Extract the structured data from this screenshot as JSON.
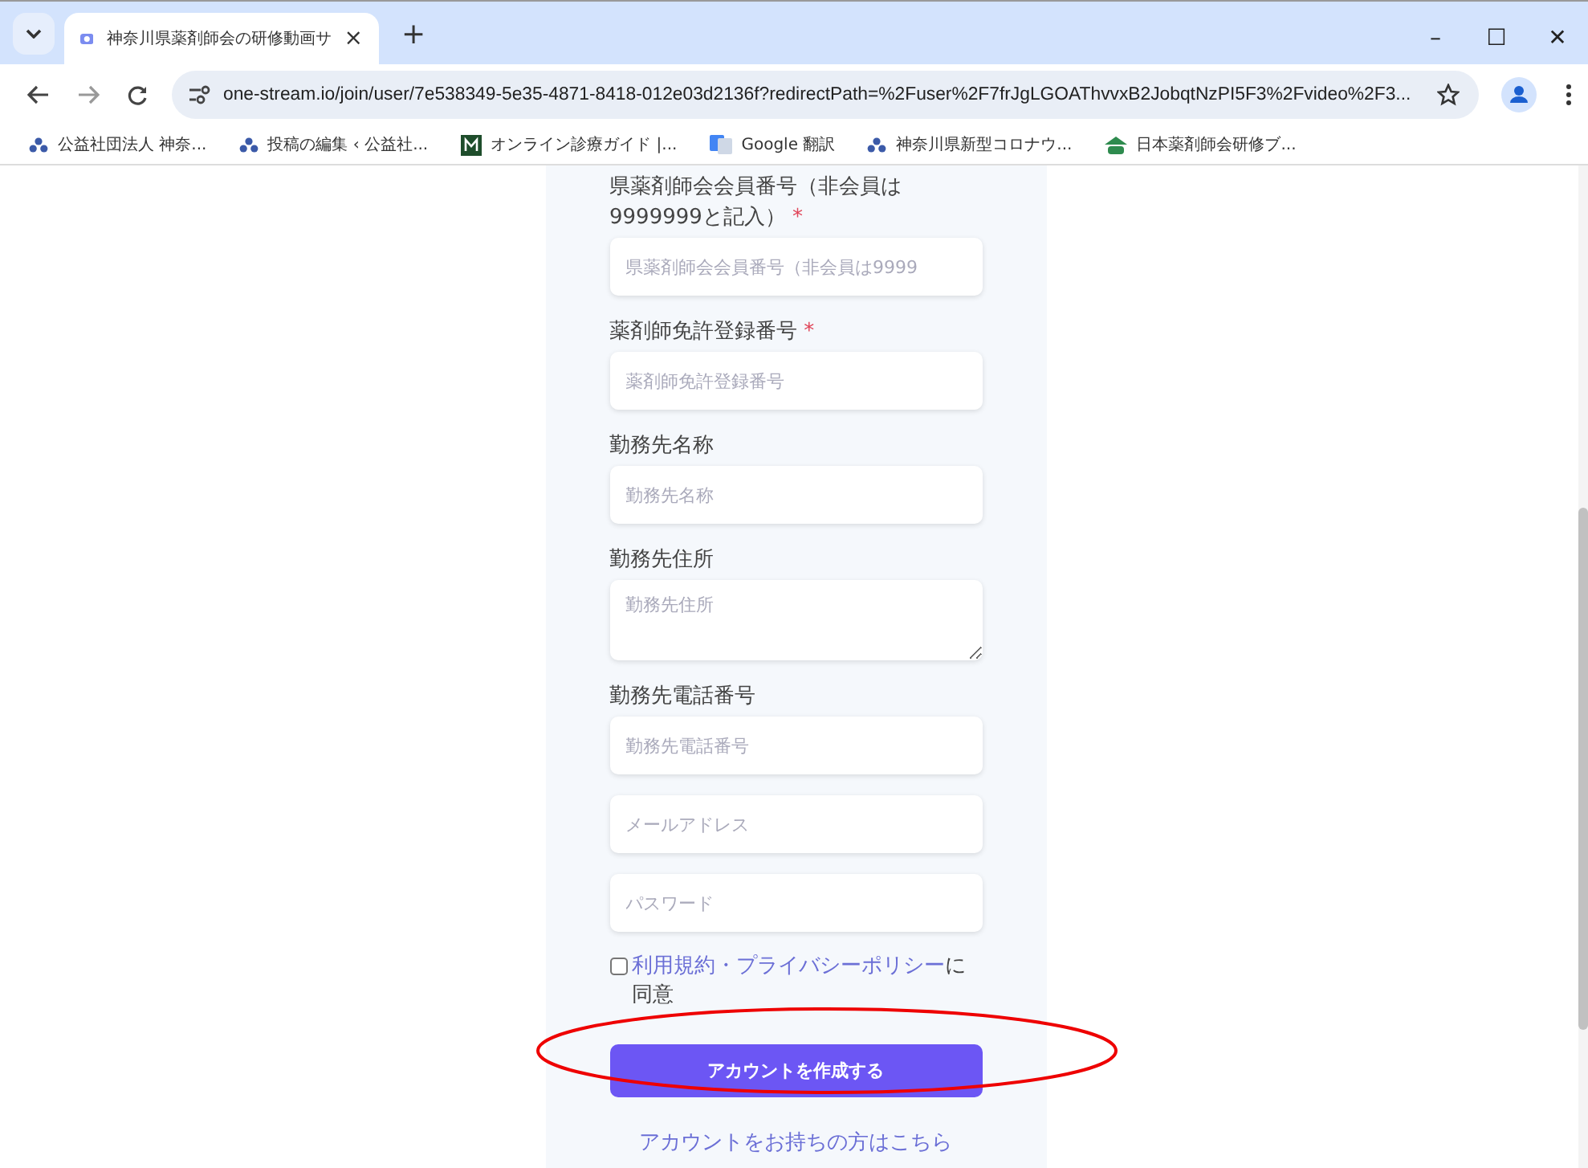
{
  "browser": {
    "tab": {
      "title": "神奈川県薬剤師会の研修動画サ",
      "close": "×"
    },
    "new_tab": "+",
    "window_controls": [
      "–",
      "☐",
      "✕"
    ],
    "url": "one-stream.io/join/user/7e538349-5e35-4871-8418-012e03d2136f?redirectPath=%2Fuser%2F7frJgLGOAThvvxB2JobqtNzPI5F3%2Fvideo%2F3...",
    "bookmarks": [
      {
        "label": "公益社団法人 神奈...",
        "kind": "people"
      },
      {
        "label": "投稿の編集 ‹ 公益社...",
        "kind": "people"
      },
      {
        "label": "オンライン診療ガイド |...",
        "kind": "m"
      },
      {
        "label": "Google 翻訳",
        "kind": "translate"
      },
      {
        "label": "神奈川県新型コロナウ...",
        "kind": "people"
      },
      {
        "label": "日本薬剤師会研修ブ...",
        "kind": "green"
      }
    ]
  },
  "form": {
    "fields": [
      {
        "label": "県薬剤師会会員番号（非会員は9999999と記入）",
        "required_mark": "*",
        "kind": "input",
        "placeholder": "県薬剤師会会員番号（非会員は9999"
      },
      {
        "label": "薬剤師免許登録番号",
        "required_mark": "*",
        "kind": "input",
        "placeholder": "薬剤師免許登録番号"
      },
      {
        "label": "勤務先名称",
        "kind": "input",
        "placeholder": "勤務先名称"
      },
      {
        "label": "勤務先住所",
        "kind": "textarea",
        "placeholder": "勤務先住所"
      },
      {
        "label": "勤務先電話番号",
        "kind": "input",
        "placeholder": "勤務先電話番号"
      },
      {
        "kind": "input",
        "placeholder": "メールアドレス"
      },
      {
        "kind": "password",
        "placeholder": "パスワード"
      }
    ],
    "consent": {
      "checked": false,
      "link": "利用規約・プライバシーポリシー",
      "text": "に同意"
    },
    "submit": "アカウントを作成する",
    "login_link": "アカウントをお持ちの方はこちら"
  }
}
